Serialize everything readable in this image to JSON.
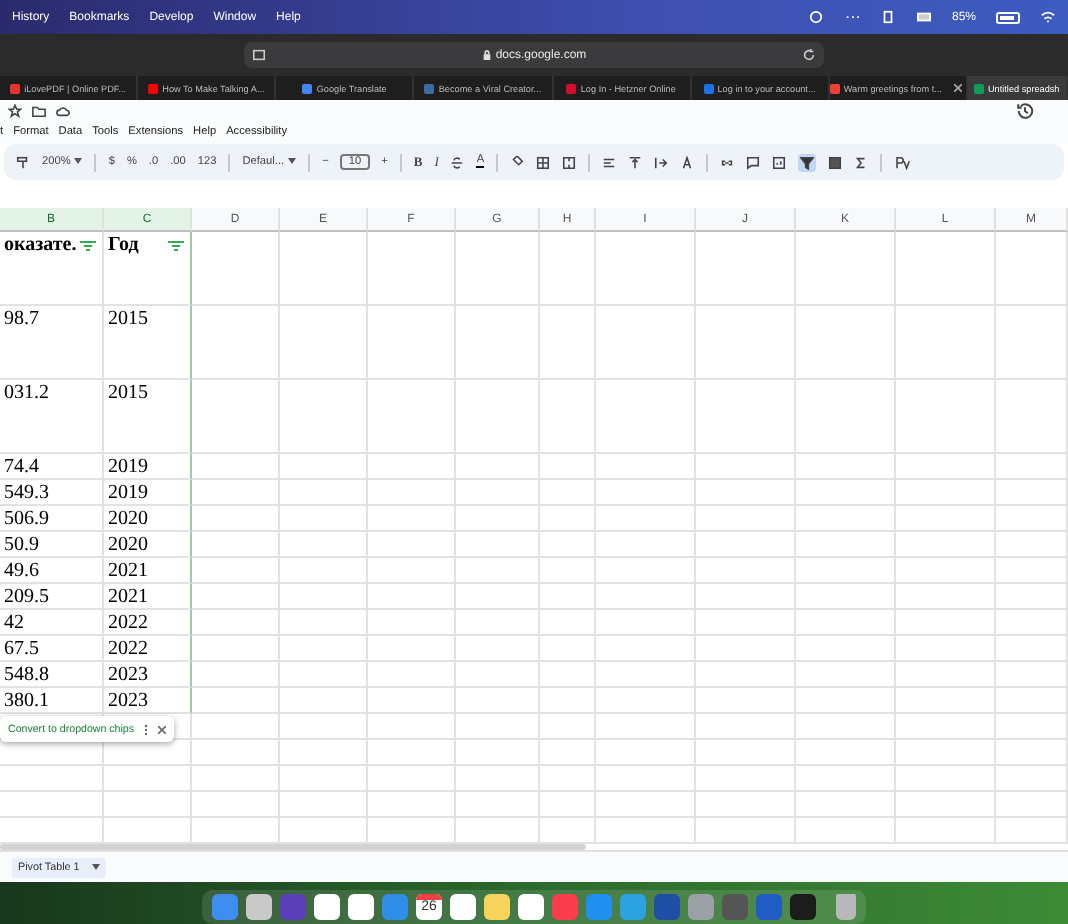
{
  "menu_bar": {
    "items": [
      "History",
      "Bookmarks",
      "Develop",
      "Window",
      "Help"
    ],
    "battery": "85%"
  },
  "browser": {
    "url": "docs.google.com",
    "tabs": [
      {
        "title": "iLovePDF | Online PDF...",
        "selected": false,
        "color": "#e5322d"
      },
      {
        "title": "How To Make Talking A...",
        "selected": false,
        "color": "#ff0000"
      },
      {
        "title": "Google Translate",
        "selected": false,
        "color": "#4285f4"
      },
      {
        "title": "Become a Viral Creator...",
        "selected": false,
        "color": "#3b6ea5"
      },
      {
        "title": "Log In - Hetzner Online",
        "selected": false,
        "color": "#d50c2d"
      },
      {
        "title": "Log in to your account...",
        "selected": false,
        "color": "#1a73e8"
      },
      {
        "title": "Warm greetings from t...",
        "selected": false,
        "color": "#ea4335"
      },
      {
        "title": "Untitled spreadsh",
        "selected": true,
        "color": "#0f9d58"
      }
    ]
  },
  "docs_menu": [
    "t",
    "Format",
    "Data",
    "Tools",
    "Extensions",
    "Help",
    "Accessibility"
  ],
  "toolbar": {
    "zoom": "200%",
    "currency": "$",
    "percent": "%",
    "decrease_decimals": ".0",
    "increase_decimals": ".00",
    "number_format": "123",
    "font": "Defaul...",
    "minus": "−",
    "font_size": "10",
    "plus": "+",
    "bold": "B",
    "italic": "I",
    "text_color": "A",
    "filter_on": true
  },
  "sheet": {
    "columns": [
      {
        "label": "B",
        "selected": true
      },
      {
        "label": "C",
        "selected": true
      },
      {
        "label": "D",
        "selected": false
      },
      {
        "label": "E",
        "selected": false
      },
      {
        "label": "F",
        "selected": false
      },
      {
        "label": "G",
        "selected": false
      },
      {
        "label": "H",
        "selected": false
      },
      {
        "label": "I",
        "selected": false
      },
      {
        "label": "J",
        "selected": false
      },
      {
        "label": "K",
        "selected": false
      },
      {
        "label": "L",
        "selected": false
      },
      {
        "label": "M",
        "selected": false
      }
    ],
    "header": [
      {
        "text": "оказате.",
        "filter": true
      },
      {
        "text": "Год",
        "filter": true
      }
    ],
    "rows": [
      [
        "98.7",
        "2015"
      ],
      [
        "031.2",
        "2015"
      ],
      [
        "74.4",
        "2019"
      ],
      [
        "549.3",
        "2019"
      ],
      [
        "506.9",
        "2020"
      ],
      [
        "50.9",
        "2020"
      ],
      [
        "49.6",
        "2021"
      ],
      [
        "209.5",
        "2021"
      ],
      [
        "42",
        "2022"
      ],
      [
        "67.5",
        "2022"
      ],
      [
        "548.8",
        "2023"
      ],
      [
        "380.1",
        "2023"
      ]
    ],
    "chip": "Convert to dropdown chips"
  },
  "sheet_tabs": [
    {
      "label": "Pivot Table 1",
      "selected": true
    }
  ],
  "dock": {
    "calendar_day": "26"
  }
}
